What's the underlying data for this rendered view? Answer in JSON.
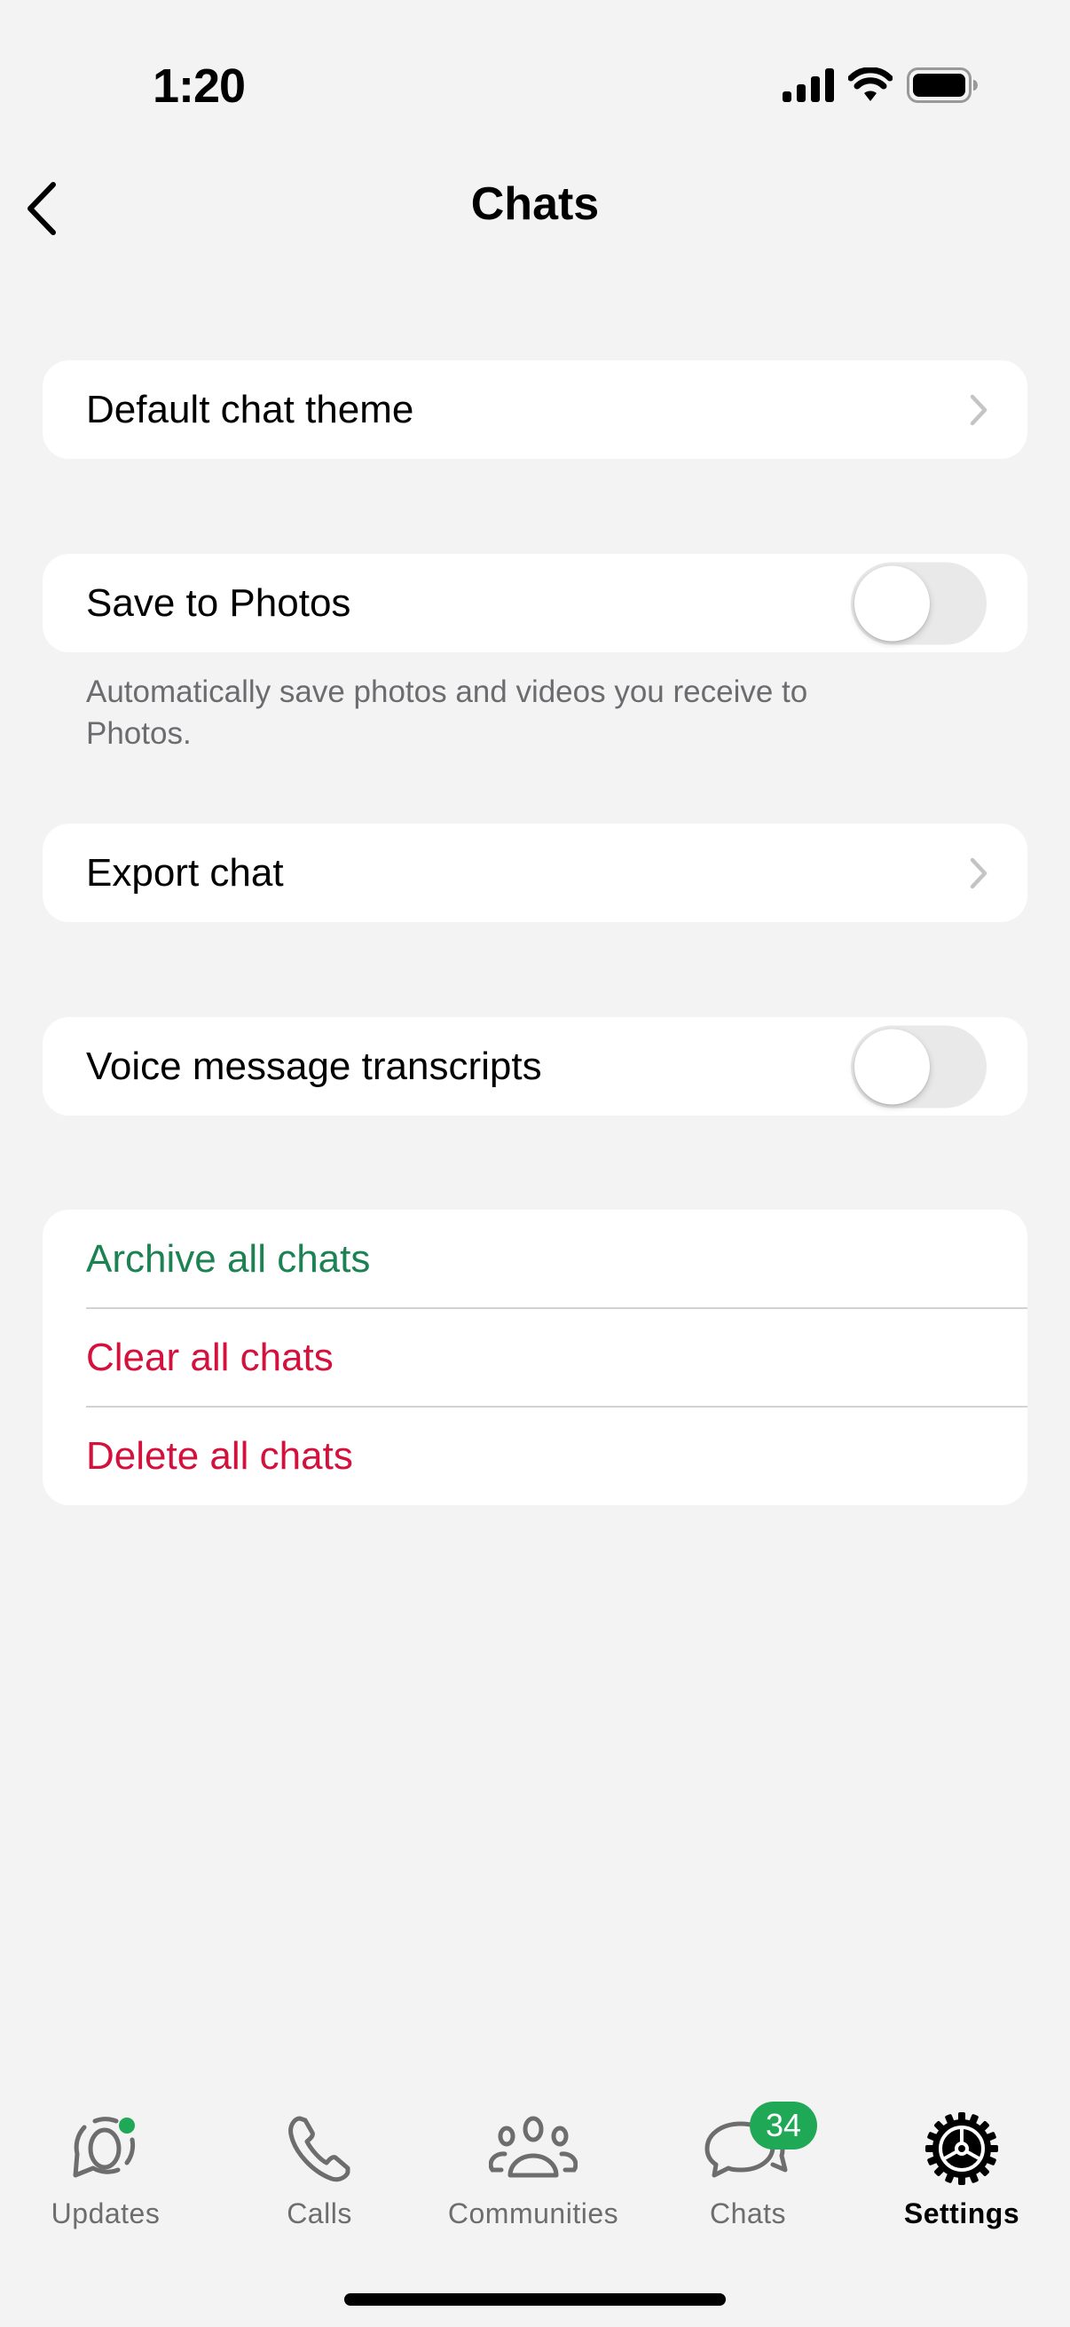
{
  "status_bar": {
    "time": "1:20",
    "icons": [
      "signal-icon",
      "wifi-icon",
      "battery-icon"
    ]
  },
  "nav": {
    "title": "Chats",
    "back_icon": "chevron-left-icon"
  },
  "settings": {
    "default_theme": {
      "label": "Default chat theme"
    },
    "save_to_photos": {
      "label": "Save to Photos",
      "enabled": false,
      "footnote": "Automatically save photos and videos you receive to Photos."
    },
    "export_chat": {
      "label": "Export chat"
    },
    "voice_transcripts": {
      "label": "Voice message transcripts",
      "enabled": false
    },
    "actions": [
      {
        "label": "Archive all chats",
        "color": "#1d8253"
      },
      {
        "label": "Clear all chats",
        "color": "#d4103c"
      },
      {
        "label": "Delete all chats",
        "color": "#d4103c"
      }
    ]
  },
  "tab_bar": {
    "tabs": [
      {
        "label": "Updates",
        "icon": "updates-icon",
        "dot": true
      },
      {
        "label": "Calls",
        "icon": "phone-icon"
      },
      {
        "label": "Communities",
        "icon": "communities-icon"
      },
      {
        "label": "Chats",
        "icon": "chats-icon",
        "badge": "34"
      },
      {
        "label": "Settings",
        "icon": "gear-icon",
        "active": true
      }
    ]
  },
  "colors": {
    "accent_green": "#1fa855",
    "destructive_red": "#d4103c",
    "background": "#f3f3f3"
  }
}
